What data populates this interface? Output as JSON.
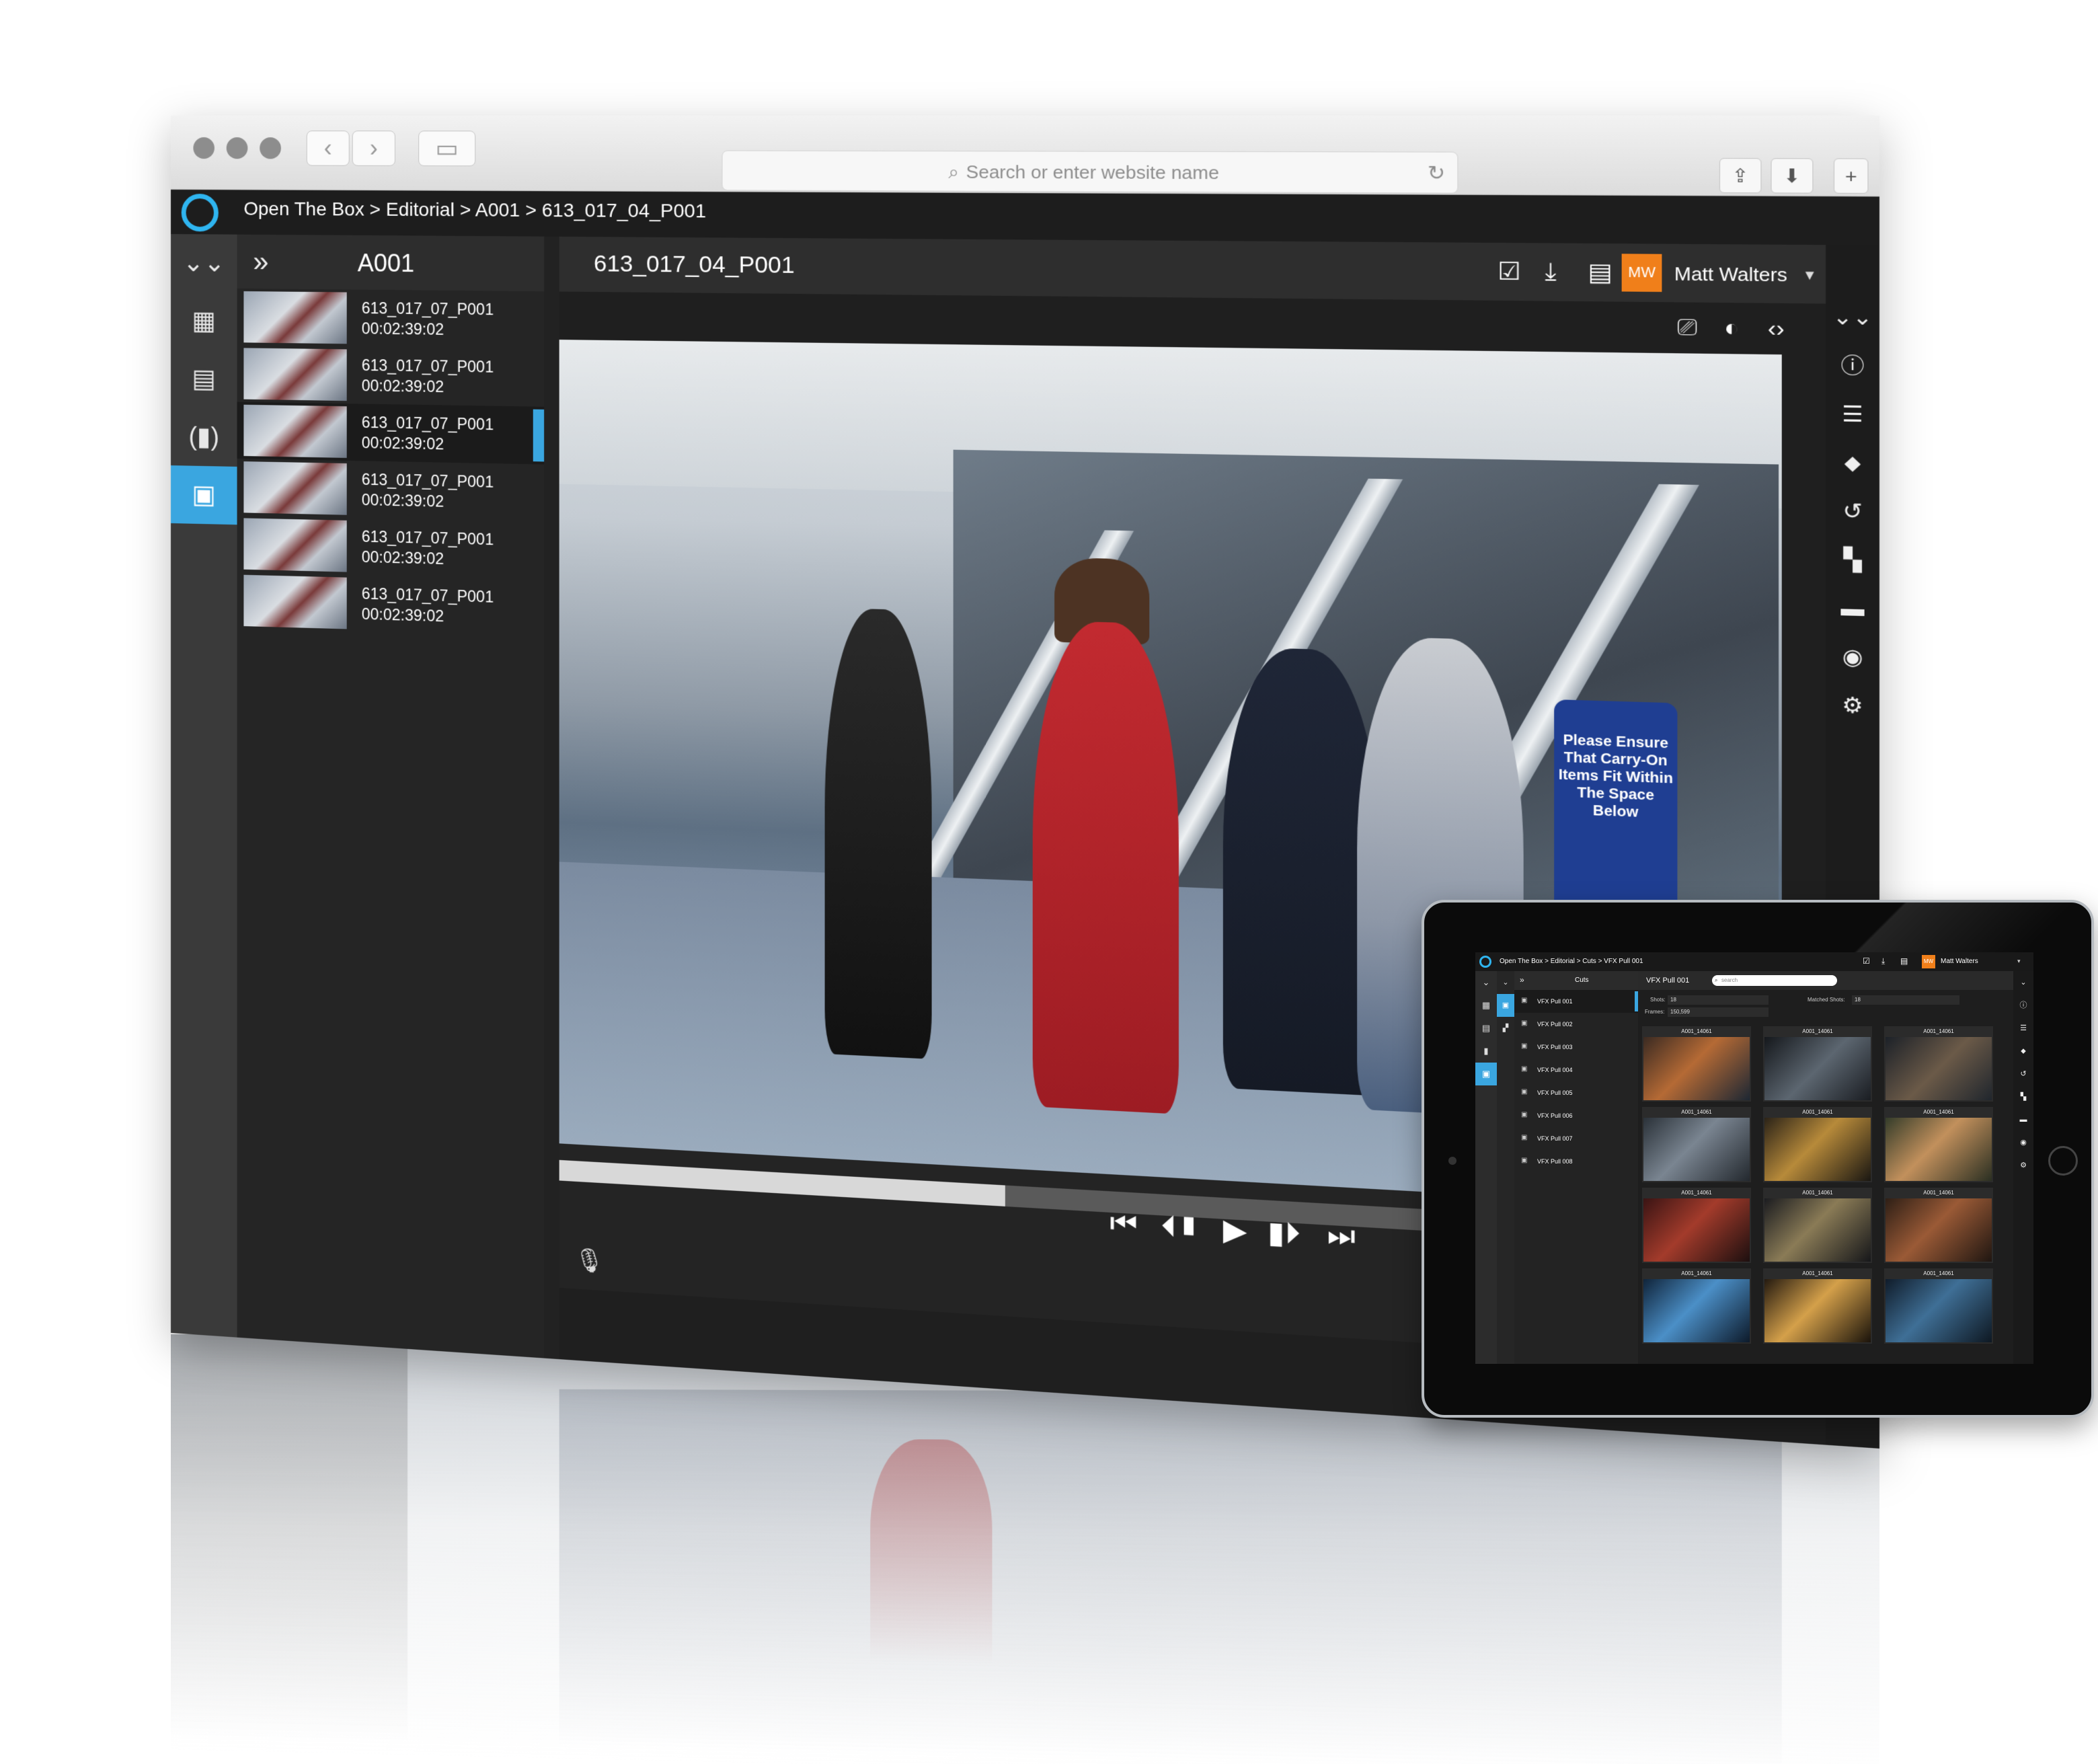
{
  "browser": {
    "url_placeholder": "Search or enter website name",
    "nav_back": "‹",
    "nav_forward": "›",
    "sidebar_toggle": "▭",
    "share_icon": "⇪",
    "download_icon": "⬇",
    "new_tab_icon": "+",
    "search_glyph": "⌕",
    "reload_glyph": "↻"
  },
  "app": {
    "breadcrumb": "Open The Box > Editorial >  A001 > 613_017_04_P001",
    "left_rail_icons": [
      "⌄⌄",
      "▦",
      "▤",
      "(▮)",
      "▣"
    ],
    "clip_list": {
      "collapse_glyph": "»",
      "title": "A001",
      "items": [
        {
          "name": "613_017_07_P001",
          "timecode": "00:02:39:02"
        },
        {
          "name": "613_017_07_P001",
          "timecode": "00:02:39:02"
        },
        {
          "name": "613_017_07_P001",
          "timecode": "00:02:39:02"
        },
        {
          "name": "613_017_07_P001",
          "timecode": "00:02:39:02"
        },
        {
          "name": "613_017_07_P001",
          "timecode": "00:02:39:02"
        },
        {
          "name": "613_017_07_P001",
          "timecode": "00:02:39:02"
        }
      ],
      "active_index": 2
    },
    "main": {
      "clip_title": "613_017_04_P001",
      "toolbar_icons": {
        "approve": "☑",
        "download": "⤓",
        "list": "▤"
      },
      "user_initials": "MW",
      "user_name": "Matt Walters",
      "user_caret": "▾",
      "viewer_tools": {
        "annotate": "⎚",
        "compass": "◐",
        "code": "‹›"
      },
      "sign_text": "Please Ensure That Carry-On Items Fit Within The Space Below",
      "progress": 0.38,
      "transport": {
        "skip_start": "⏮",
        "prev_frame": "⏴▮",
        "play": "▶",
        "next_frame": "▮⏵",
        "skip_end": "⏭"
      },
      "mic_icon": "🎙"
    },
    "right_rail_icons": [
      "⌄⌄",
      "ⓘ",
      "☰",
      "⬥",
      "↺",
      "▚",
      "▬",
      "◉",
      "⚙"
    ]
  },
  "tablet": {
    "breadcrumb": "Open The Box > Editorial > Cuts > VFX Pull 001",
    "user_initials": "MW",
    "user_name": "Matt Walters",
    "caret": "▾",
    "list_title": "Cuts",
    "list_collapse": "»",
    "cuts": [
      "VFX Pull 001",
      "VFX Pull 002",
      "VFX Pull 003",
      "VFX Pull 004",
      "VFX Pull 005",
      "VFX Pull 006",
      "VFX Pull 007",
      "VFX Pull 008"
    ],
    "main_title": "VFX Pull 001",
    "search_placeholder": "search",
    "stats": {
      "shots_label": "Shots:",
      "shots_value": "18",
      "matched_label": "Matched Shots:",
      "matched_value": "18",
      "frames_label": "Frames:",
      "frames_value": "150,599"
    },
    "thumbs": [
      "A001_14061",
      "A001_14061",
      "A001_14061",
      "A001_14061",
      "A001_14061",
      "A001_14061",
      "A001_14061",
      "A001_14061",
      "A001_14061",
      "A001_14061",
      "A001_14061",
      "A001_14061"
    ],
    "rail_icons": [
      "⌄",
      "▦",
      "▤",
      "▮",
      "▣"
    ],
    "rail2_icons": [
      "⌄",
      "▣",
      "▞"
    ],
    "right_icons": [
      "⌄",
      "ⓘ",
      "☰",
      "⬥",
      "↺",
      "▚",
      "▬",
      "◉",
      "⚙"
    ],
    "top_icons": [
      "☑",
      "⤓",
      "▤"
    ]
  },
  "colors": {
    "accent": "#3aa6e0",
    "avatar": "#f07f1a",
    "sign": "#1f3e92",
    "dress": "#b3232b"
  }
}
